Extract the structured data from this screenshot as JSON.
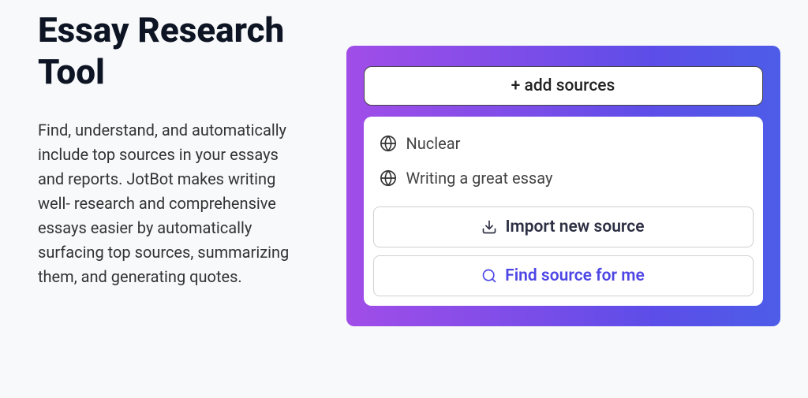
{
  "heading": "Essay Research Tool",
  "description": "Find, understand, and automatically include top sources in your essays and reports. JotBot makes writing well- research and comprehensive essays easier by automatically surfacing top sources, summarizing them, and generating quotes.",
  "addSourcesLabel": "+ add sources",
  "sources": [
    {
      "label": "Nuclear"
    },
    {
      "label": "Writing a great essay"
    }
  ],
  "importLabel": "Import new source",
  "findLabel": "Find source for me"
}
